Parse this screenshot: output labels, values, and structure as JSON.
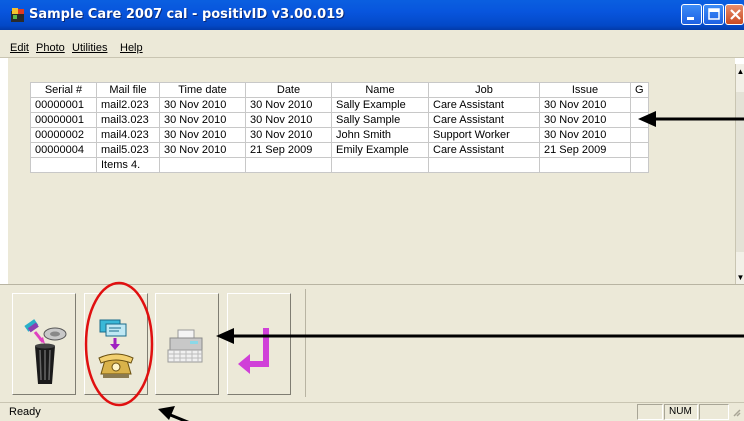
{
  "window": {
    "title": "Sample Care 2007 cal - positivID v3.00.019",
    "icon": "app-logo-icon",
    "title_bar_color": "#0a5fe0"
  },
  "menu": [
    {
      "label": "Edit"
    },
    {
      "label": "Photo"
    },
    {
      "label": "Utilities"
    },
    {
      "label": "Help"
    }
  ],
  "table": {
    "columns": [
      "Serial #",
      "Mail file",
      "Time date",
      "Date",
      "Name",
      "Job",
      "Issue",
      "G"
    ],
    "rows": [
      [
        "00000001",
        "mail2.023",
        "30 Nov 2010",
        "30 Nov 2010",
        "Sally Example",
        "Care Assistant",
        "30 Nov 2010",
        ""
      ],
      [
        "00000001",
        "mail3.023",
        "30 Nov 2010",
        "30 Nov 2010",
        "Sally Sample",
        "Care Assistant",
        "30 Nov 2010",
        ""
      ],
      [
        "00000002",
        "mail4.023",
        "30 Nov 2010",
        "30 Nov 2010",
        "John Smith",
        "Support Worker",
        "30 Nov 2010",
        ""
      ],
      [
        "00000004",
        "mail5.023",
        "30 Nov 2010",
        "21 Sep 2009",
        "Emily Example",
        "Care Assistant",
        "21 Sep 2009",
        ""
      ],
      [
        "",
        "Items 4.",
        "",
        "",
        "",
        "",
        "",
        ""
      ]
    ]
  },
  "toolbar": {
    "buttons": [
      {
        "icon": "recycle-bin-icon"
      },
      {
        "icon": "mail-to-phone-icon"
      },
      {
        "icon": "printer-icon"
      },
      {
        "icon": "return-arrow-icon"
      }
    ]
  },
  "status": {
    "text": "Ready",
    "num": "NUM"
  },
  "annotations": {
    "arrow_color": "#000000",
    "circle_color": "#e01010"
  }
}
